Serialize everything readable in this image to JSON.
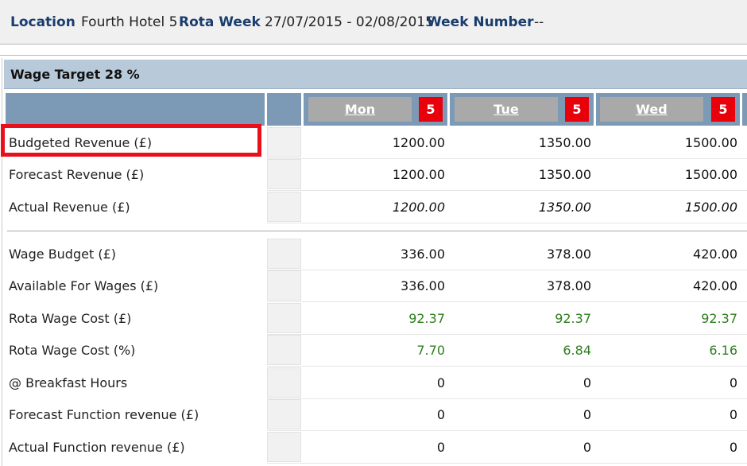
{
  "header": {
    "location_label": "Location",
    "location_value": "Fourth Hotel 5",
    "rota_week_label": "Rota Week",
    "rota_week_value": "27/07/2015 - 02/08/2015",
    "week_number_label": "Week Number",
    "week_number_value": "--"
  },
  "wage_target": "Wage Target 28 %",
  "days": [
    {
      "name": "Mon",
      "badge": "5"
    },
    {
      "name": "Tue",
      "badge": "5"
    },
    {
      "name": "Wed",
      "badge": "5"
    }
  ],
  "rows": [
    {
      "label": "Budgeted Revenue (£)",
      "values": [
        "1200.00",
        "1350.00",
        "1500.00"
      ],
      "style": "normal"
    },
    {
      "label": "Forecast Revenue (£)",
      "values": [
        "1200.00",
        "1350.00",
        "1500.00"
      ],
      "style": "normal"
    },
    {
      "label": "Actual Revenue (£)",
      "values": [
        "1200.00",
        "1350.00",
        "1500.00"
      ],
      "style": "italic"
    },
    {
      "label": "Wage Budget (£)",
      "values": [
        "336.00",
        "378.00",
        "420.00"
      ],
      "style": "normal"
    },
    {
      "label": "Available For Wages (£)",
      "values": [
        "336.00",
        "378.00",
        "420.00"
      ],
      "style": "normal"
    },
    {
      "label": "Rota Wage Cost (£)",
      "values": [
        "92.37",
        "92.37",
        "92.37"
      ],
      "style": "green"
    },
    {
      "label": "Rota Wage Cost (%)",
      "values": [
        "7.70",
        "6.84",
        "6.16"
      ],
      "style": "green"
    },
    {
      "label": "@ Breakfast Hours",
      "values": [
        "0",
        "0",
        "0"
      ],
      "style": "normal"
    },
    {
      "label": "Forecast Function revenue (£)",
      "values": [
        "0",
        "0",
        "0"
      ],
      "style": "normal"
    },
    {
      "label": "Actual Function revenue (£)",
      "values": [
        "0",
        "0",
        "0"
      ],
      "style": "normal"
    }
  ],
  "colors": {
    "header_blue": "#1a3d6e",
    "column_header": "#7c9ab5",
    "badge_red": "#e8000a",
    "positive_green": "#2e7d1e",
    "highlight_red": "#e8101a"
  }
}
